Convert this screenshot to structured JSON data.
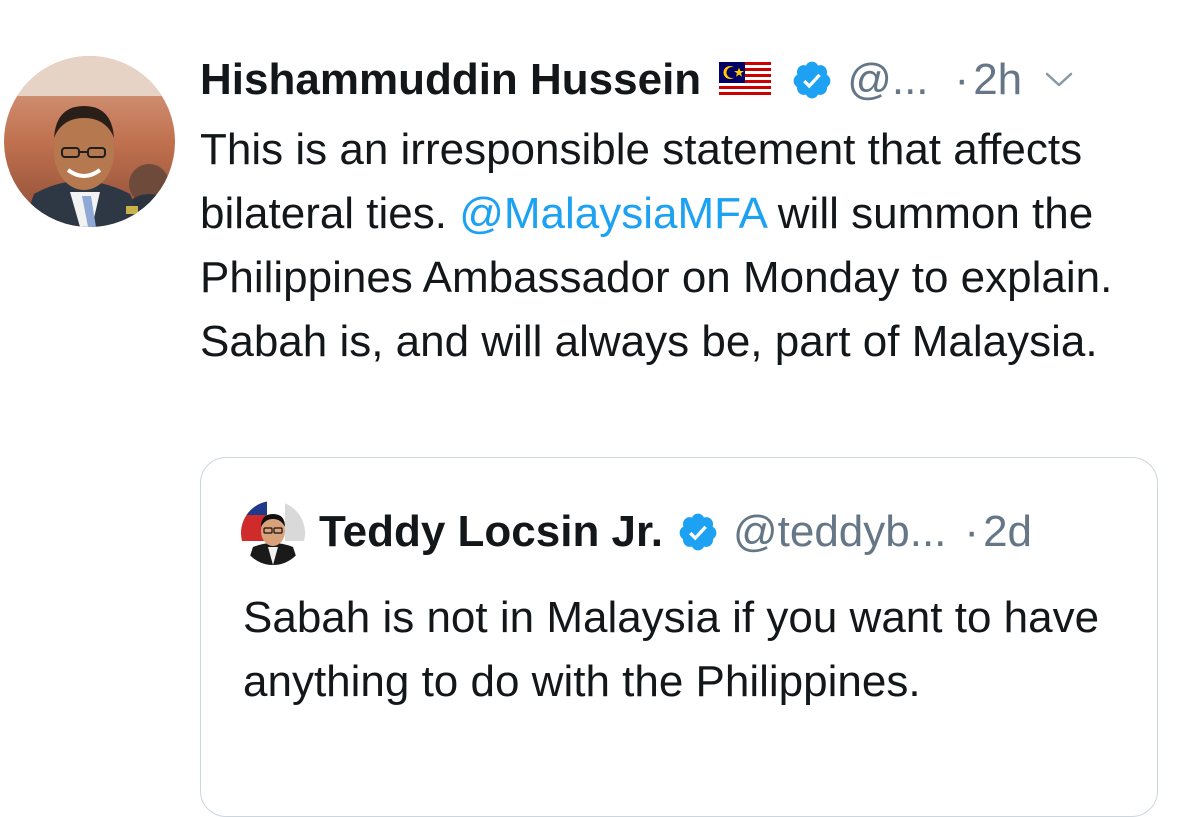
{
  "tweet": {
    "author": {
      "display_name": "Hishammuddin Hussein",
      "flag_icon": "malaysia-flag-icon",
      "verified_icon": "verified-badge-icon",
      "handle": "@...",
      "separator": "·",
      "time": "2h"
    },
    "text_before": "This is an irresponsible statement that affects bilateral ties. ",
    "mention": "@MalaysiaMFA",
    "text_after": " will summon the Philippines Ambassador on Monday to explain. Sabah is, and will always be, part of Malaysia.",
    "menu_icon": "chevron-down-icon"
  },
  "quoted_tweet": {
    "author": {
      "display_name": "Teddy Locsin Jr.",
      "verified_icon": "verified-badge-icon",
      "handle": "@teddyb...",
      "separator": "·",
      "time": "2d"
    },
    "text": "Sabah is not in Malaysia if you want to have anything to do with the Philippines."
  },
  "colors": {
    "link": "#1da1f2",
    "verified": "#1da1f2",
    "secondary_text": "#657786",
    "primary_text": "#14171a",
    "border": "#ccd6dd"
  }
}
